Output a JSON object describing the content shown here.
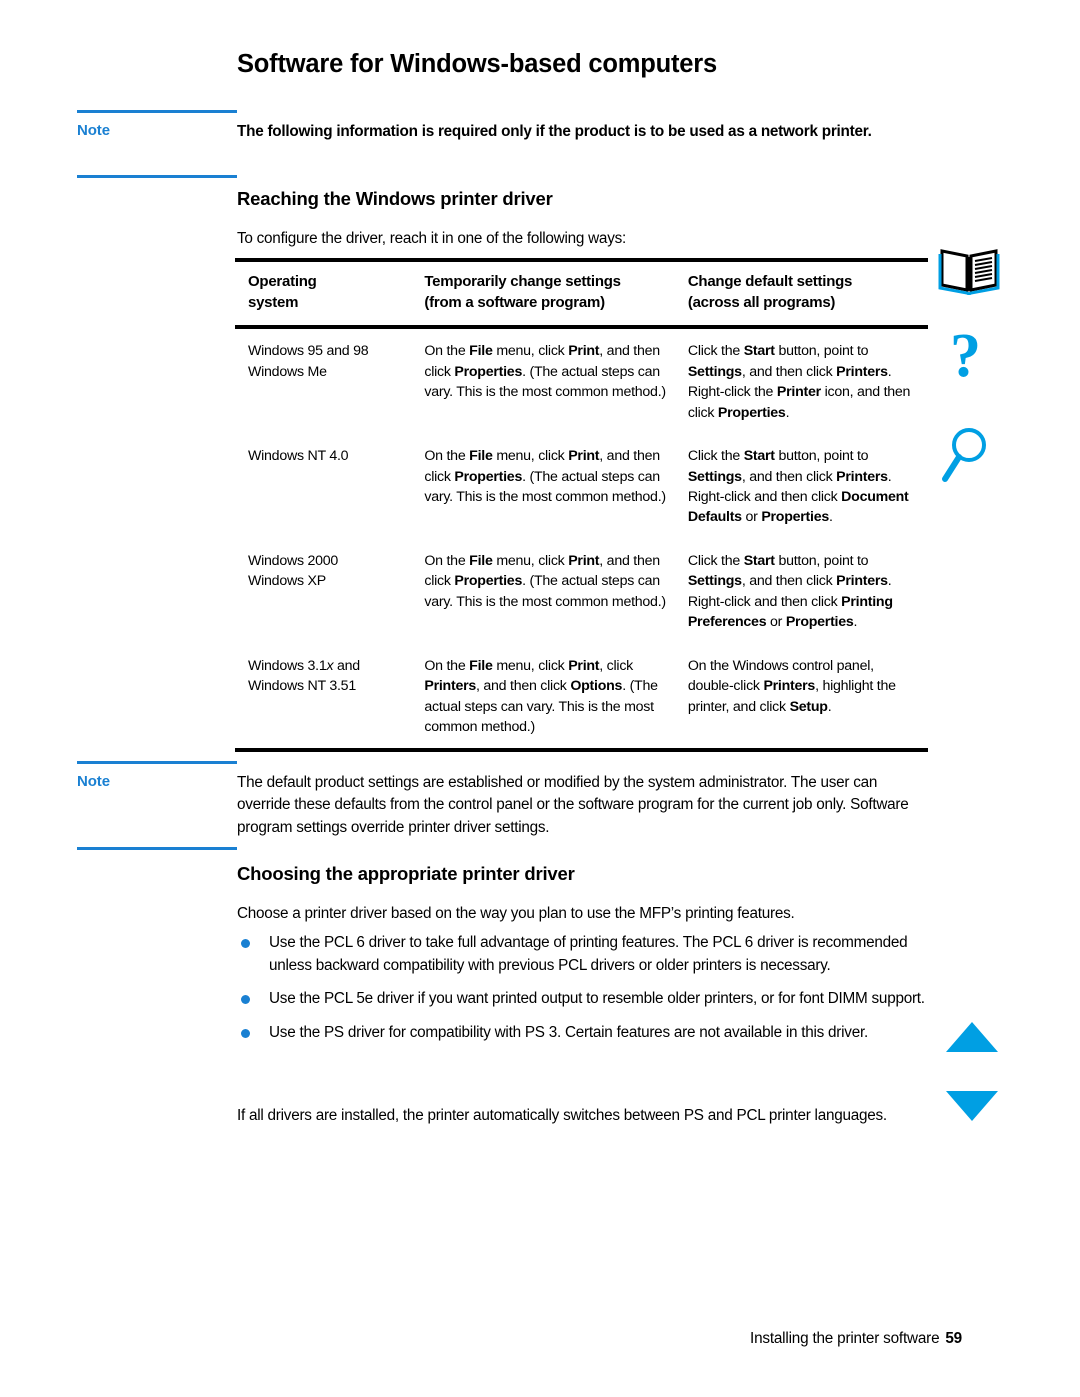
{
  "page": {
    "title": "Software for Windows-based computers",
    "footer_text": "Installing the printer software",
    "footer_page_number": "59",
    "accent_color": "#1a80d2",
    "icon_color": "#009fe3"
  },
  "note_1": {
    "label": "Note",
    "text": "The following information is required only if the product is to be used as a network printer."
  },
  "note_2": {
    "label": "Note",
    "text": "The default product settings are established or modified by the system administrator. The user can override these defaults from the control panel or the software program for the current job only. Software program settings override printer driver settings."
  },
  "section_reaching": {
    "heading": "Reaching the Windows printer driver",
    "intro": "To configure the driver, reach it in one of the following ways:"
  },
  "driver_table": {
    "headers": [
      "Operating system",
      "Temporarily change settings (from a software program)",
      "Change default settings (across all programs)"
    ],
    "headers_lines": [
      [
        "Operating",
        "system"
      ],
      [
        "Temporarily change settings",
        "(from a software program)"
      ],
      [
        "Change default settings",
        "(across all programs)"
      ]
    ],
    "rows": [
      {
        "os": "Windows 95 and 98 Windows Me",
        "os_lines": [
          "Windows 95 and 98",
          "Windows Me"
        ],
        "temporary": "On the File menu, click Print, and then click Properties. (The actual steps can vary. This is the most common method.)",
        "default": "Click the Start button, point to Settings, and then click Printers. Right-click the Printer icon, and then click Properties."
      },
      {
        "os": "Windows NT 4.0",
        "os_lines": [
          "Windows NT 4.0"
        ],
        "temporary": "On the File menu, click Print, and then click Properties. (The actual steps can vary. This is the most common method.)",
        "default": "Click the Start button, point to Settings, and then click Printers. Right-click and then click Document Defaults or Properties."
      },
      {
        "os": "Windows 2000 Windows XP",
        "os_lines": [
          "Windows 2000",
          "Windows XP"
        ],
        "temporary": "On the File menu, click Print, and then click Properties. (The actual steps can vary. This is the most common method.)",
        "default": "Click the Start button, point to Settings, and then click Printers. Right-click and then click Printing Preferences or Properties."
      },
      {
        "os": "Windows 3.1x and Windows NT 3.51",
        "os_lines": [
          "Windows 3.1x and",
          "Windows NT 3.51"
        ],
        "temporary": "On the File menu, click Print, click Printers, and then click Options. (The actual steps can vary. This is the most common method.)",
        "default": "On the Windows control panel, double-click Printers, highlight the printer, and click Setup."
      }
    ]
  },
  "section_choosing": {
    "heading": "Choosing the appropriate printer driver",
    "intro": "Choose a printer driver based on the way you plan to use the MFP’s printing features.",
    "bullets": [
      "Use the PCL 6 driver to take full advantage of printing features. The PCL 6 driver is recommended unless backward compatibility with previous PCL drivers or older printers is necessary.",
      "Use the PCL 5e driver if you want printed output to resemble older printers, or for font DIMM support.",
      "Use the PS driver for compatibility with PS 3. Certain features are not available in this driver."
    ],
    "closing": "If all drivers are installed, the printer automatically switches between PS and PCL printer languages."
  },
  "nav_icons": [
    {
      "name": "open-book-icon",
      "label": "Table of contents"
    },
    {
      "name": "question-mark-icon",
      "label": "Index"
    },
    {
      "name": "magnifying-glass-icon",
      "label": "Search"
    },
    {
      "name": "triangle-up-icon",
      "label": "Previous page"
    },
    {
      "name": "triangle-down-icon",
      "label": "Next page"
    }
  ]
}
